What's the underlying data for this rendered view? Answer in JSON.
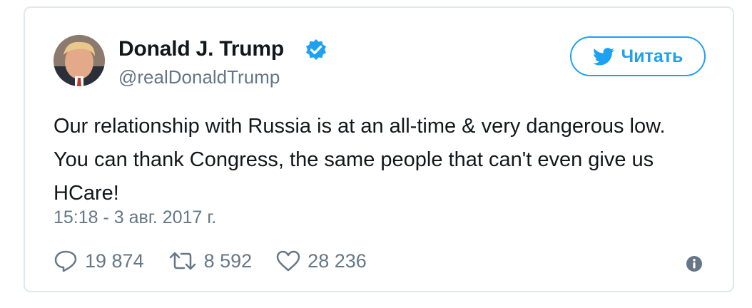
{
  "tweet": {
    "author_name": "Donald J. Trump",
    "handle": "@realDonaldTrump",
    "follow_label": "Читать",
    "text": "Our relationship with Russia is at an all-time & very dangerous low. You can thank Congress, the same people that can't even give us HCare!",
    "timestamp": "15:18 - 3 авг. 2017 г.",
    "replies": "19 874",
    "retweets": "8 592",
    "likes": "28 236"
  },
  "icons": {
    "verified": "verified-badge-icon",
    "follow": "twitter-bird-icon",
    "reply": "reply-icon",
    "retweet": "retweet-icon",
    "like": "heart-icon",
    "info": "info-icon"
  },
  "colors": {
    "brand_blue": "#1da1f2",
    "secondary_text": "#657786",
    "primary_text": "#14171a",
    "border": "#e1e8ed"
  }
}
